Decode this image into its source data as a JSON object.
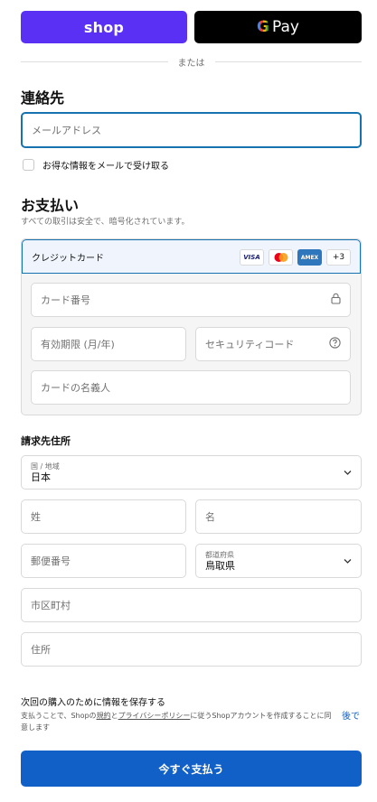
{
  "express": {
    "shop_label": "shop",
    "gpay_g": "G",
    "gpay_label": "Pay"
  },
  "divider_text": "または",
  "contact": {
    "heading": "連絡先",
    "email_placeholder": "メールアドレス",
    "marketing_checkbox_label": "お得な情報をメールで受け取る",
    "marketing_checked": false
  },
  "payment": {
    "heading": "お支払い",
    "subtitle": "すべての取引は安全で、暗号化されています。",
    "method_label": "クレジットカード",
    "card_brands": [
      "VISA",
      "Mastercard",
      "AMEX"
    ],
    "more_brands": "+3",
    "card_number_placeholder": "カード番号",
    "expiry_placeholder": "有効期限 (月/年)",
    "cvc_placeholder": "セキュリティコード",
    "name_on_card_placeholder": "カードの名義人"
  },
  "billing": {
    "heading": "請求先住所",
    "country_label": "国 / 地域",
    "country_value": "日本",
    "last_name_placeholder": "姓",
    "first_name_placeholder": "名",
    "postal_placeholder": "郵便番号",
    "prefecture_label": "都道府県",
    "prefecture_value": "鳥取県",
    "city_placeholder": "市区町村",
    "address_placeholder": "住所"
  },
  "save_info": {
    "title": "次回の購入のために情報を保存する",
    "desc_prefix": "支払うことで、Shopの",
    "terms_link": "規約",
    "desc_and": "と",
    "privacy_link": "プライバシーポリシー",
    "desc_suffix": "に従うShopアカウントを作成することに同意します",
    "later_link": "後で"
  },
  "pay_now_label": "今すぐ支払う",
  "colors": {
    "shop_purple": "#5a31f4",
    "primary_blue": "#1060c8",
    "focus_blue": "#1773b0"
  }
}
